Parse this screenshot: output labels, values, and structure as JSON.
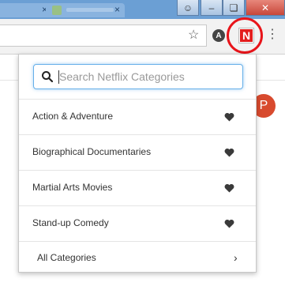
{
  "browser": {
    "title_bar_color": "#6b9fd4",
    "tabs": [
      {
        "icon": "page-favicon"
      },
      {
        "icon": "page-favicon"
      }
    ],
    "window_buttons": {
      "user": "☺",
      "minimize": "–",
      "maximize": "❏",
      "close": "✕"
    },
    "toolbar": {
      "bookmark_icon": "star-icon",
      "extension_a_letter": "A",
      "netflix_ext_letter": "N",
      "menu_icon": "⋮",
      "highlight_color": "#e8141a"
    }
  },
  "page": {
    "avatar_letter": "P",
    "avatar_color": "#d84a2e"
  },
  "popup": {
    "search": {
      "placeholder": "Search Netflix Categories",
      "value": ""
    },
    "categories": [
      {
        "label": "Action & Adventure",
        "favorite": true
      },
      {
        "label": "Biographical Documentaries",
        "favorite": true
      },
      {
        "label": "Martial Arts Movies",
        "favorite": true
      },
      {
        "label": "Stand-up Comedy",
        "favorite": true
      }
    ],
    "all_categories_label": "All Categories",
    "chevron": "›"
  }
}
